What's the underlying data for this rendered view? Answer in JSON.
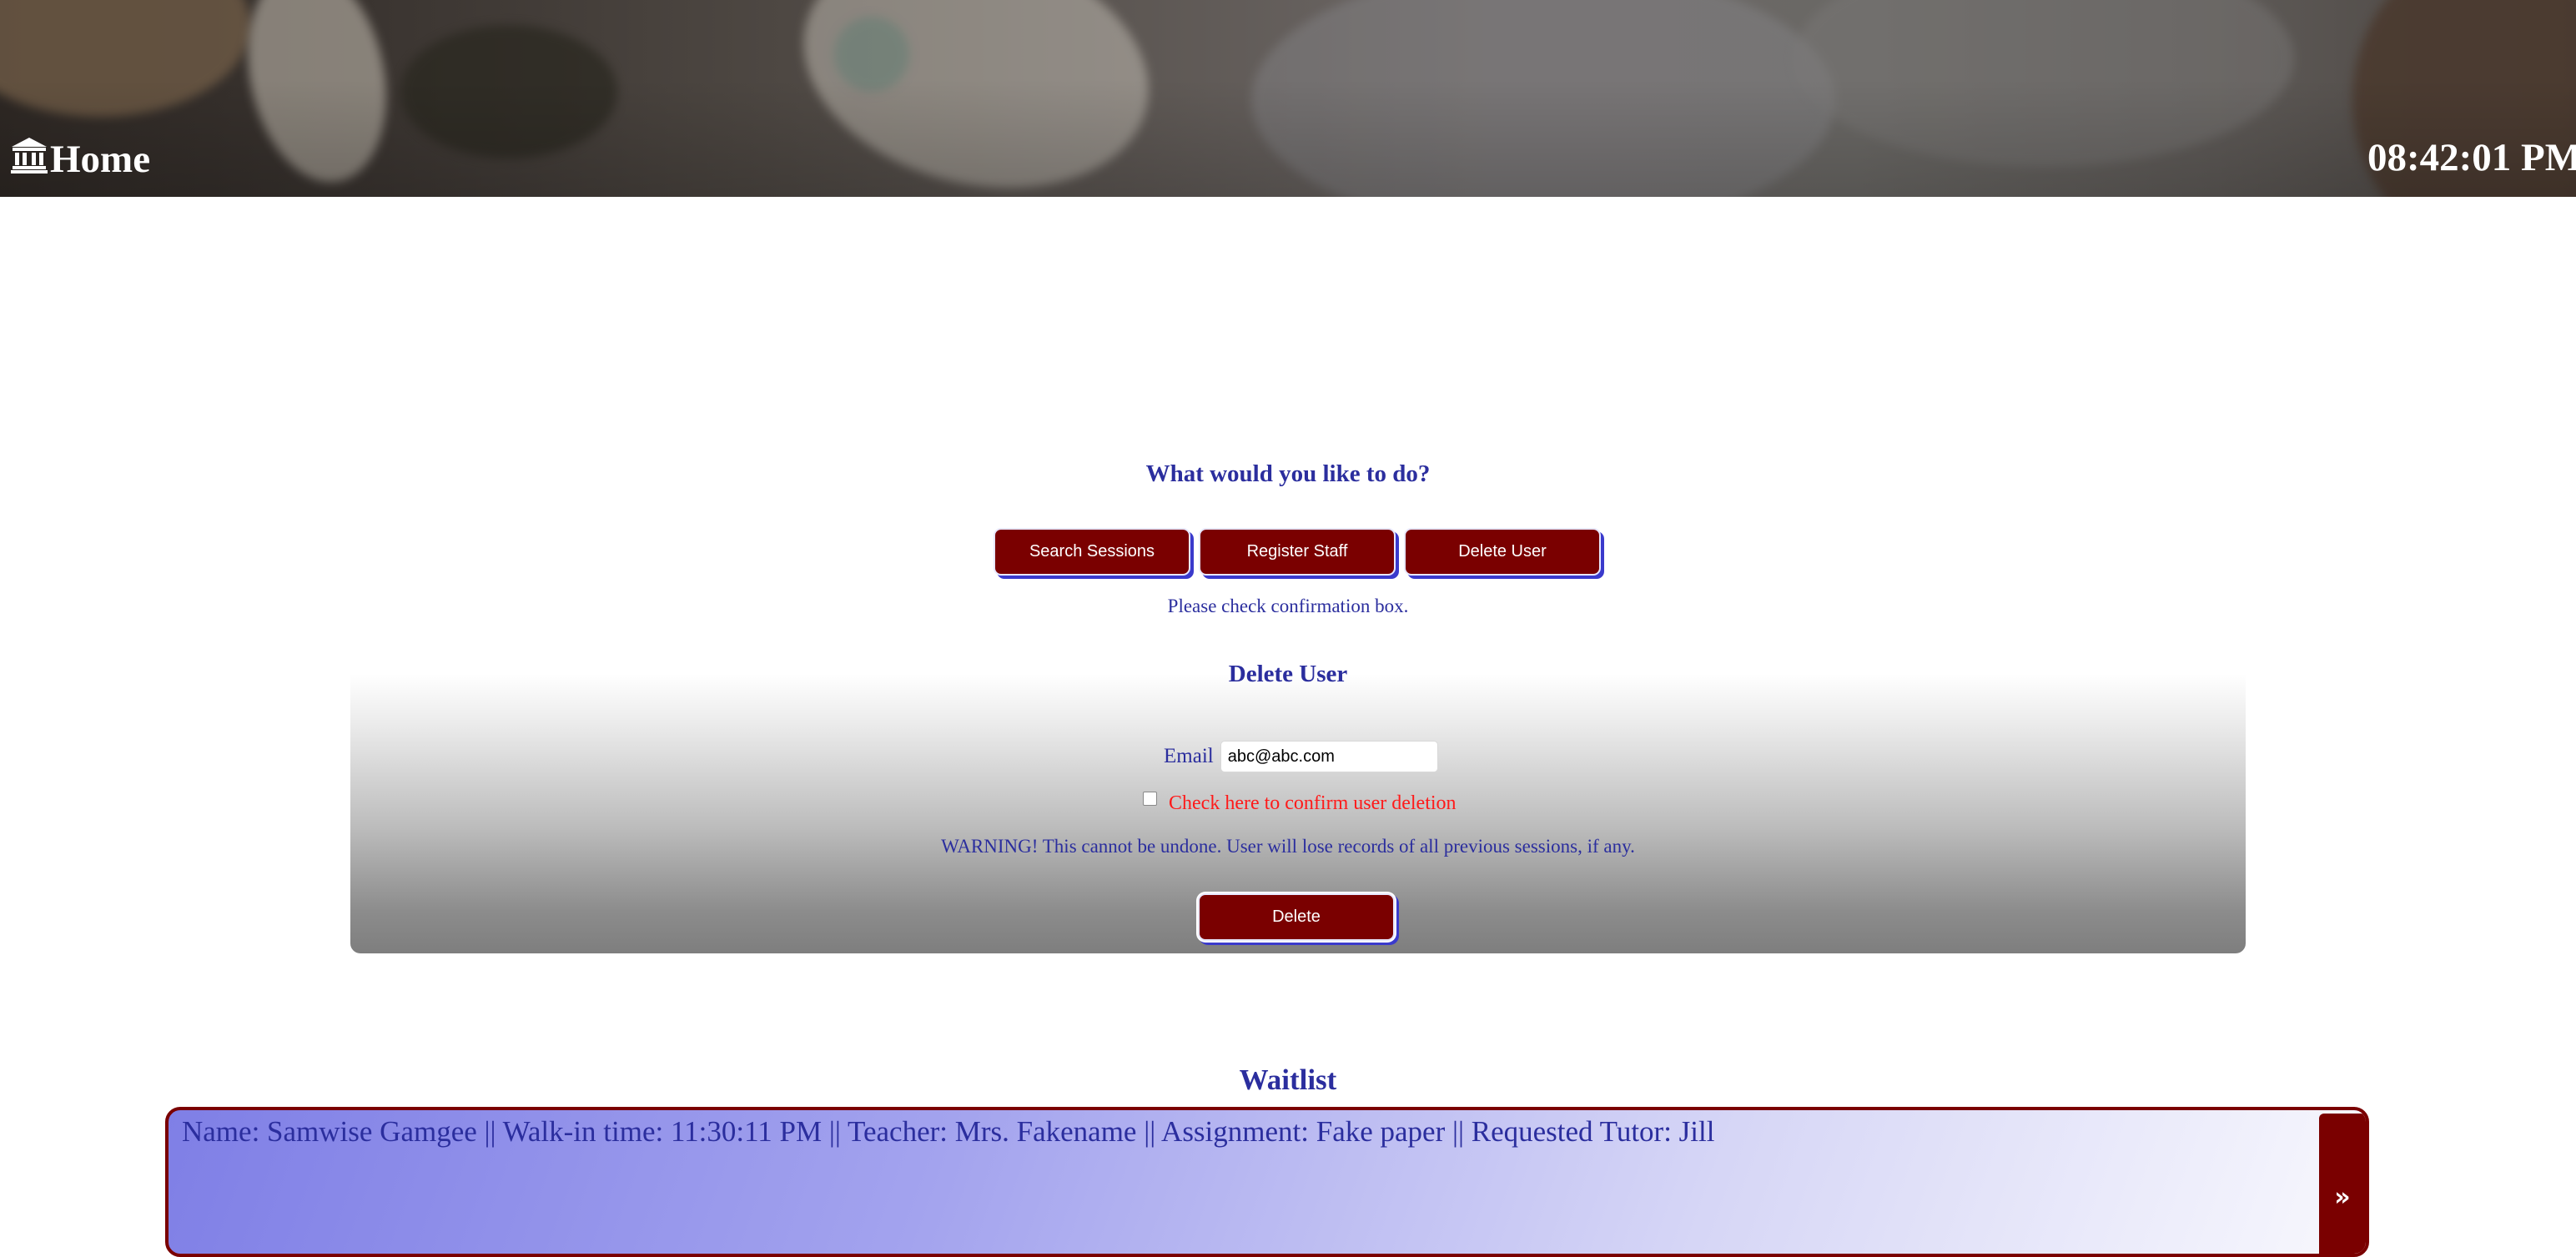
{
  "header": {
    "home_label": "Home",
    "home_icon": "bank-icon",
    "clock": "08:42:01 PM"
  },
  "main": {
    "prompt": "What would you like to do?",
    "actions": [
      {
        "label": "Search Sessions"
      },
      {
        "label": "Register Staff"
      },
      {
        "label": "Delete User"
      }
    ],
    "status_message": "Please check confirmation box."
  },
  "delete_user": {
    "title": "Delete User",
    "email_label": "Email",
    "email_value": "abc@abc.com",
    "confirm_label": "Check here to confirm user deletion",
    "confirm_checked": false,
    "warning": "WARNING! This cannot be undone. User will lose records of all previous sessions, if any.",
    "delete_label": "Delete"
  },
  "waitlist": {
    "title": "Waitlist",
    "entries": [
      {
        "text": "Name: Samwise Gamgee || Walk-in time: 11:30:11 PM || Teacher: Mrs. Fakename || Assignment: Fake paper || Requested Tutor: Jill"
      }
    ],
    "next_symbol": "»"
  },
  "colors": {
    "accent": "#2b2e9e",
    "button": "#7a0000",
    "warning": "#ff1a1a"
  }
}
